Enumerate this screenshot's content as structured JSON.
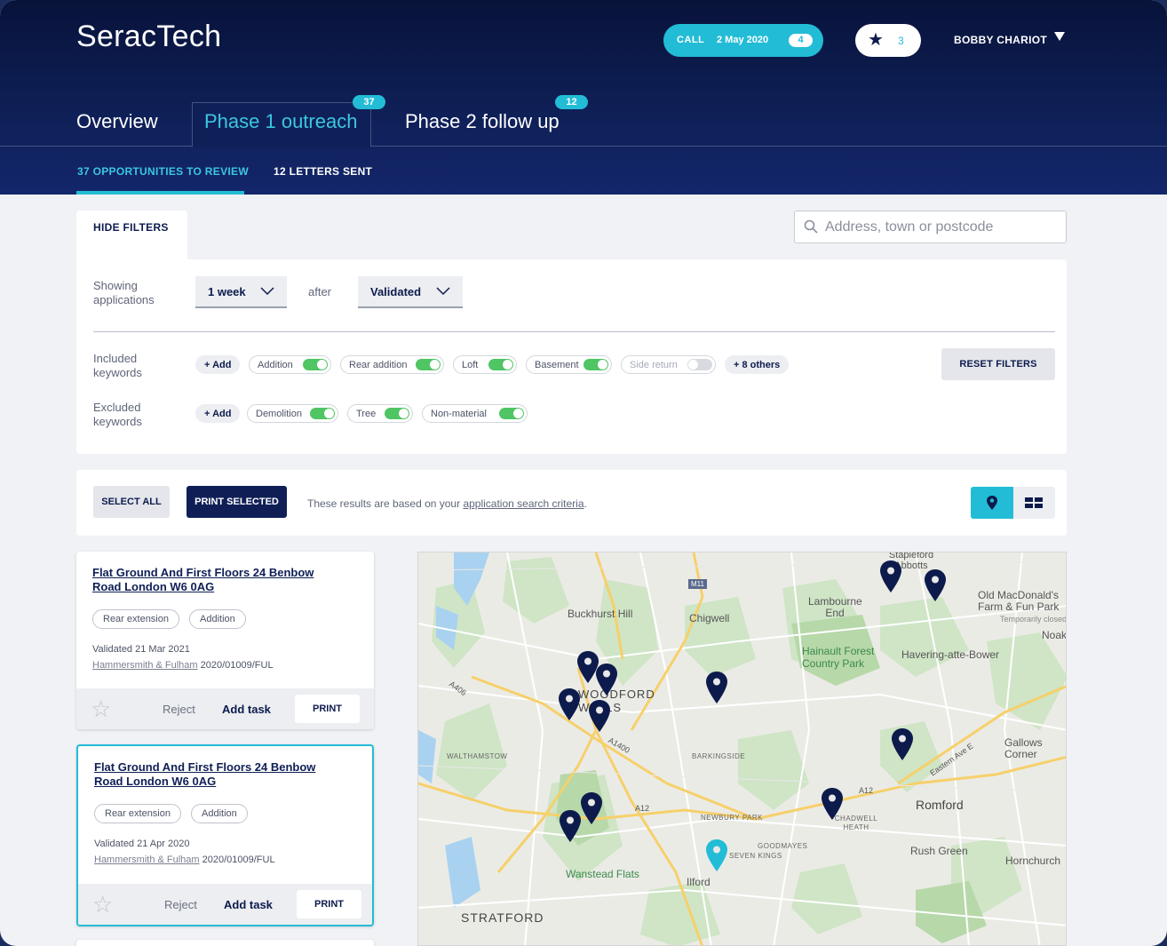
{
  "app": {
    "brand": "SeracTech"
  },
  "header": {
    "call_label": "CALL",
    "call_date": "2 May 2020",
    "call_count": "4",
    "favourites_count": "3",
    "user_name": "BOBBY CHARIOT"
  },
  "tabs": [
    {
      "label": "Overview",
      "badge": ""
    },
    {
      "label": "Phase 1 outreach",
      "badge": "37"
    },
    {
      "label": "Phase 2 follow up",
      "badge": "12"
    }
  ],
  "subnav": {
    "opportunities": "37 OPPORTUNITIES TO REVIEW",
    "letters": "12 LETTERS SENT"
  },
  "search": {
    "placeholder": "Address, town or postcode"
  },
  "filters": {
    "hide_label": "HIDE FILTERS",
    "showing_label": "Showing applications",
    "period": "1 week",
    "after_label": "after",
    "status": "Validated",
    "included_label": "Included keywords",
    "excluded_label": "Excluded keywords",
    "add_label": "+ Add",
    "included": [
      {
        "label": "Addition",
        "on": true
      },
      {
        "label": "Rear addition",
        "on": true
      },
      {
        "label": "Loft",
        "on": true
      },
      {
        "label": "Basement",
        "on": true
      },
      {
        "label": "Side return",
        "on": false
      }
    ],
    "more_label": "+ 8 others",
    "excluded": [
      {
        "label": "Demolition",
        "on": true
      },
      {
        "label": "Tree",
        "on": true
      },
      {
        "label": "Non-material",
        "on": true
      }
    ],
    "reset_label": "RESET FILTERS"
  },
  "actions": {
    "select_all": "SELECT ALL",
    "print_selected": "PRINT SELECTED",
    "note_prefix": "These results are based on your ",
    "note_link": "application search criteria",
    "note_suffix": "."
  },
  "cards": [
    {
      "title": "Flat Ground And First Floors 24 Benbow Road London W6 0AG",
      "tags": [
        "Rear extension",
        "Addition"
      ],
      "validated": "Validated 21 Mar 2021",
      "council": "Hammersmith & Fulham",
      "ref": " 2020/01009/FUL",
      "reject": "Reject",
      "add_task": "Add task",
      "print": "PRINT"
    },
    {
      "title": "Flat Ground And First Floors 24 Benbow Road London W6 0AG",
      "tags": [
        "Rear extension",
        "Addition"
      ],
      "validated": "Validated 21 Apr 2020",
      "council": "Hammersmith & Fulham",
      "ref": " 2020/01009/FUL",
      "reject": "Reject",
      "add_task": "Add task",
      "print": "PRINT"
    }
  ],
  "map": {
    "labels": {
      "buckhurst": "Buckhurst Hill",
      "chigwell": "Chigwell",
      "lambourne": "Lambourne End",
      "stapleford": "Stapleford Abbotts",
      "oldmac": "Old MacDonald's Farm & Fun Park",
      "oldmac_note": "Temporarily closed",
      "noak": "Noak H",
      "hainault": "Hainault Forest Country Park",
      "havering": "Havering-atte-Bower",
      "woodford": "WOODFORD WELLS",
      "walthamstow": "WALTHAMSTOW",
      "barkingside": "BARKINGSIDE",
      "gallows": "Gallows Corner",
      "romford": "Romford",
      "newbury": "NEWBURY PARK",
      "chadwell": "CHADWELL HEATH",
      "goodmayes": "GOODMAYES",
      "sevenkings": "SEVEN KINGS",
      "rushgreen": "Rush Green",
      "hornchurch": "Hornchurch",
      "wanstead": "Wanstead Flats",
      "ilford": "Ilford",
      "stratford": "STRATFORD",
      "m11": "M11",
      "a12": "A12",
      "a406": "A406",
      "a1400": "A1400",
      "eastern": "Eastern Ave E"
    }
  },
  "colors": {
    "navy": "#0f1f56",
    "accent": "#23bcd6",
    "toggle_on": "#4fc563"
  }
}
